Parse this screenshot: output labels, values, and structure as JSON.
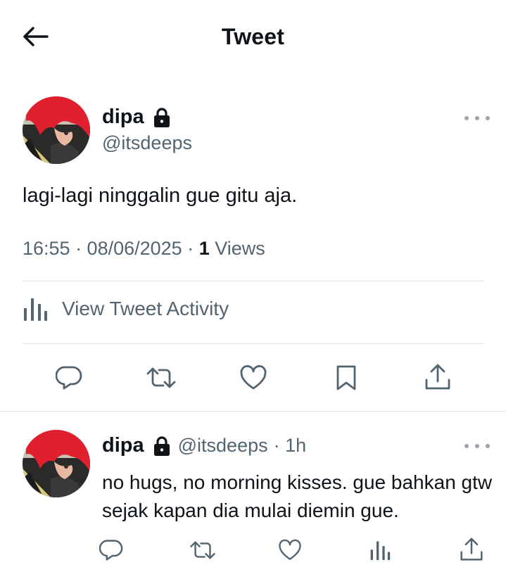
{
  "header": {
    "title": "Tweet"
  },
  "main_tweet": {
    "author_name": "dipa",
    "author_handle": "@itsdeeps",
    "text": "lagi-lagi ninggalin gue gitu aja.",
    "time": "16:55 · 08/06/2025 · ",
    "views_count": "1",
    "views_label": " Views",
    "activity_label": "View Tweet Activity"
  },
  "reply_tweet": {
    "author_name": "dipa",
    "author_handle": "@itsdeeps",
    "age": "· 1h",
    "text": "no hugs, no morning kisses. gue bahkan gtw sejak kapan dia mulai diemin gue."
  },
  "icons": {
    "back": "arrow-left-icon",
    "lock": "lock-icon",
    "more": "more-icon",
    "analytics": "analytics-icon",
    "reply": "reply-icon",
    "retweet": "retweet-icon",
    "like": "heart-icon",
    "bookmark": "bookmark-icon",
    "share": "share-icon"
  },
  "colors": {
    "text": "#0f1419",
    "secondary": "#536471",
    "divider": "#dfe3e6",
    "avatar_hair": "#e0202f"
  }
}
